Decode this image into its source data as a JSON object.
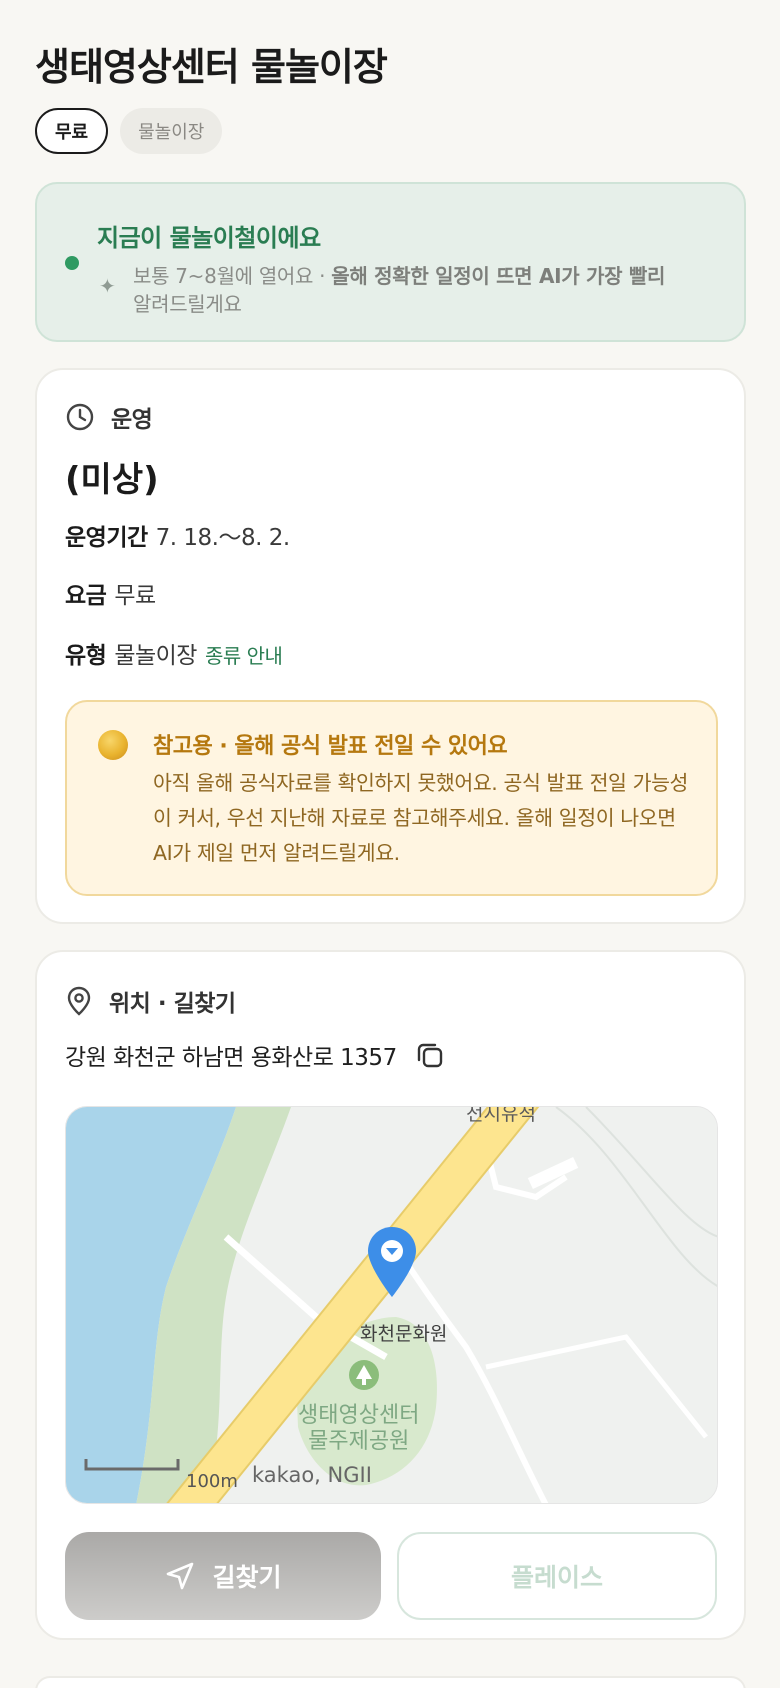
{
  "page": {
    "title": "생태영상센터 물놀이장",
    "chips": [
      "무료",
      "물놀이장"
    ]
  },
  "season": {
    "title": "지금이 물놀이철이에요",
    "desc_plain": "보통 7~8월에 열어요 · ",
    "desc_bold": "올해 정확한 일정이 뜨면 AI가 가장 빨리",
    "desc_tail": "알려드릴게요"
  },
  "operation": {
    "section_title": "운영",
    "status": "(미상)",
    "period_label": "운영기간",
    "period_value": "7. 18.～8. 2.",
    "fee_label": "요금",
    "fee_value": "무료",
    "type_label": "유형",
    "type_value": "물놀이장",
    "type_link": "종류 안내",
    "notice_title": "참고용 · 올해 공식 발표 전일 수 있어요",
    "notice_body": "아직 올해 공식자료를 확인하지 못했어요. 공식 발표 전일 가능성이 커서, 우선 지난해 자료로 참고해주세요. 올해 일정이 나오면 AI가 제일 먼저 알려드릴게요."
  },
  "location": {
    "section_title": "위치 · 길찾기",
    "address": "강원 화천군 하남면 용화산로 1357",
    "map": {
      "label_top": "전시유적",
      "label_culture": "화천문화원",
      "label_park_line1": "생태영상센터",
      "label_park_line2": "물주제공원",
      "scale": "100m",
      "attribution": "kakao, NGII"
    },
    "directions_button": "길찾기",
    "place_button": "플레이스"
  },
  "colors": {
    "accent_green": "#2a7d52",
    "notice_brown": "#b5780f",
    "pin_blue": "#3d8ee8"
  },
  "icons": [
    "clock-icon",
    "location-pin-icon",
    "copy-icon",
    "sparkle-icon",
    "moon-icon",
    "navigation-arrow-icon",
    "map-pin-icon",
    "tree-icon"
  ]
}
